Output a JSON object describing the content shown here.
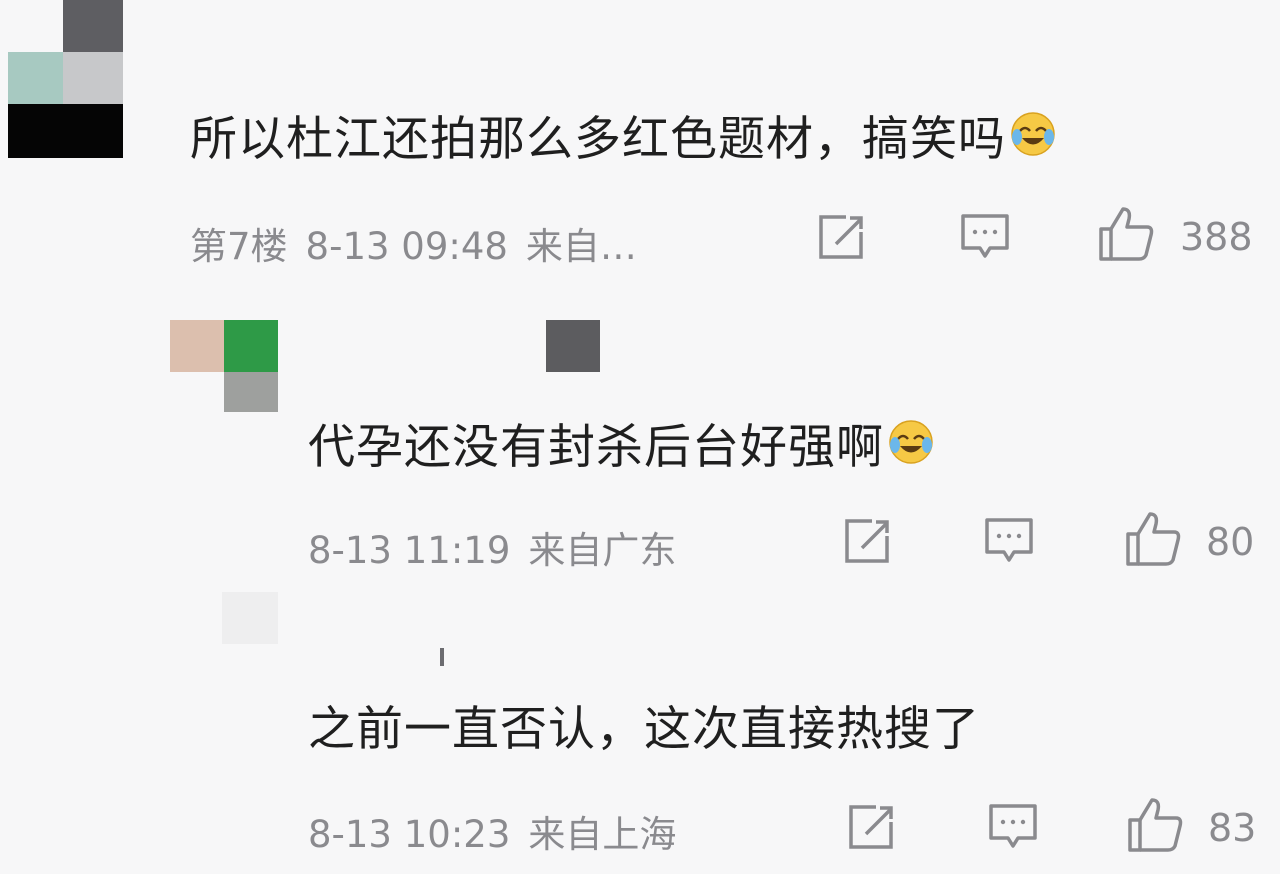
{
  "comments": [
    {
      "text": "所以杜江还拍那么多红色题材，搞笑吗",
      "emoji": "laugh-cry-emoji",
      "floor": "第7楼",
      "time": "8-13 09:48",
      "source": "来自…",
      "likes": "388"
    },
    {
      "text": "代孕还没有封杀后台好强啊",
      "emoji": "laugh-cry-emoji",
      "floor": "",
      "time": "8-13 11:19",
      "source": "来自广东",
      "likes": "80"
    },
    {
      "text": "之前一直否认，这次直接热搜了",
      "emoji": "",
      "floor": "",
      "time": "8-13 10:23",
      "source": "来自上海",
      "likes": "83"
    }
  ],
  "icons": {
    "share": "share-icon",
    "comment": "comment-icon",
    "like": "thumbs-up-icon"
  },
  "colors": {
    "background": "#f7f7f8",
    "text": "#1f1f1f",
    "meta": "#8a8a8e"
  }
}
